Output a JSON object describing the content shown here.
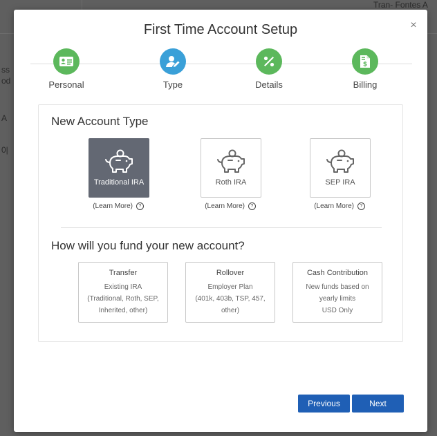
{
  "background": {
    "fragments": [
      "Tran- Fontes A",
      "ss",
      "od",
      "A",
      "0|"
    ]
  },
  "modal": {
    "title": "First Time Account Setup",
    "close_label": "×"
  },
  "stepper": {
    "steps": [
      {
        "label": "Personal",
        "icon": "id-card-icon",
        "color": "#5cb85c"
      },
      {
        "label": "Type",
        "icon": "user-edit-icon",
        "color": "#3aa0d8"
      },
      {
        "label": "Details",
        "icon": "percent-icon",
        "color": "#5cb85c"
      },
      {
        "label": "Billing",
        "icon": "invoice-dollar-icon",
        "color": "#5cb85c"
      }
    ]
  },
  "account_type": {
    "heading": "New Account Type",
    "options": [
      {
        "label": "Traditional IRA",
        "icon": "piggy-bank-icon",
        "selected": true
      },
      {
        "label": "Roth IRA",
        "icon": "piggy-bank-icon",
        "selected": false
      },
      {
        "label": "SEP IRA",
        "icon": "piggy-bank-icon",
        "selected": false
      }
    ],
    "learn_more": "(Learn More)",
    "help_glyph": "?"
  },
  "funding": {
    "heading": "How will you fund your new account?",
    "options": [
      {
        "title": "Transfer",
        "line1": "Existing IRA",
        "line2": "(Traditional, Roth, SEP,",
        "line3": "Inherited, other)"
      },
      {
        "title": "Rollover",
        "line1": "Employer Plan",
        "line2": "(401k, 403b, TSP, 457,",
        "line3": "other)"
      },
      {
        "title": "Cash Contribution",
        "line1": "New funds based on",
        "line2": "yearly limits",
        "line3": "USD Only"
      }
    ]
  },
  "footer": {
    "previous_label": "Previous",
    "next_label": "Next"
  },
  "colors": {
    "accent": "#1f5fb5",
    "selected_tile": "#636873",
    "step_green": "#5cb85c",
    "step_blue": "#3aa0d8"
  }
}
